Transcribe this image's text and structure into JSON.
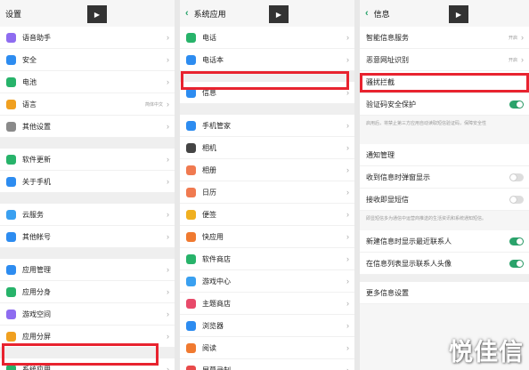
{
  "colors": {
    "accent": "#2aa36b",
    "highlight": "#e8232f"
  },
  "play_glyph": "▶",
  "panel1": {
    "title": "设置",
    "items": [
      {
        "label": "语音助手",
        "icon": "mic-icon",
        "color": "#8e6cf0"
      },
      {
        "label": "安全",
        "icon": "shield-icon",
        "color": "#2d8cf0"
      },
      {
        "label": "电池",
        "icon": "battery-icon",
        "color": "#27b36a"
      },
      {
        "label": "语言",
        "value": "简体中文",
        "icon": "globe-icon",
        "color": "#f0a020"
      },
      {
        "label": "其他设置",
        "icon": "gear-icon",
        "color": "#8a8a8a"
      },
      {
        "label": "软件更新",
        "icon": "update-icon",
        "color": "#27b36a"
      },
      {
        "label": "关于手机",
        "icon": "info-icon",
        "color": "#2d8cf0"
      },
      {
        "label": "云服务",
        "icon": "cloud-icon",
        "color": "#3aa0f0"
      },
      {
        "label": "其他帐号",
        "icon": "user-icon",
        "color": "#2d8cf0"
      },
      {
        "label": "应用管理",
        "icon": "grid-icon",
        "color": "#2d8cf0"
      },
      {
        "label": "应用分身",
        "icon": "clone-icon",
        "color": "#27b36a"
      },
      {
        "label": "游戏空间",
        "icon": "game-icon",
        "color": "#8e6cf0"
      },
      {
        "label": "应用分屏",
        "icon": "split-icon",
        "color": "#f0a020"
      },
      {
        "label": "系统应用",
        "icon": "apps-icon",
        "color": "#27b36a"
      }
    ]
  },
  "panel2": {
    "title": "系统应用",
    "items": [
      {
        "label": "电话",
        "icon": "phone-icon",
        "color": "#27b36a"
      },
      {
        "label": "电话本",
        "icon": "contacts-icon",
        "color": "#2d8cf0"
      },
      {
        "label": "信息",
        "icon": "message-icon",
        "color": "#2d8cf0"
      },
      {
        "label": "手机管家",
        "icon": "shield-icon",
        "color": "#2d8cf0"
      },
      {
        "label": "相机",
        "icon": "camera-icon",
        "color": "#444"
      },
      {
        "label": "相册",
        "icon": "photos-icon",
        "color": "#f07a50"
      },
      {
        "label": "日历",
        "icon": "calendar-icon",
        "color": "#f07a50"
      },
      {
        "label": "便签",
        "icon": "notes-icon",
        "color": "#f0b020"
      },
      {
        "label": "快应用",
        "icon": "quickapp-icon",
        "color": "#f07a30"
      },
      {
        "label": "软件商店",
        "icon": "store-icon",
        "color": "#27b36a"
      },
      {
        "label": "游戏中心",
        "icon": "star-icon",
        "color": "#3aa0f0"
      },
      {
        "label": "主题商店",
        "icon": "theme-icon",
        "color": "#e84a6a"
      },
      {
        "label": "浏览器",
        "icon": "browser-icon",
        "color": "#2d8cf0"
      },
      {
        "label": "阅读",
        "icon": "book-icon",
        "color": "#f07a30"
      },
      {
        "label": "屏幕录制",
        "icon": "record-icon",
        "color": "#e84a4a"
      }
    ]
  },
  "panel3": {
    "title": "信息",
    "smart_service": {
      "label": "智能信息服务",
      "value": "开启"
    },
    "fraud_url": {
      "label": "恶意网址识别",
      "value": "开启"
    },
    "harass": {
      "label": "骚扰拦截"
    },
    "verify_code": {
      "label": "验证码安全保护",
      "toggle": "on"
    },
    "verify_note": "启用后，将禁止第三方应用自动读取短信验证码，保障安全性",
    "notify": {
      "label": "通知管理"
    },
    "popup": {
      "label": "收到信息时弹窗显示",
      "toggle": "off"
    },
    "instant": {
      "label": "接收即显短信",
      "toggle": "off"
    },
    "instant_note": "即显短信多为通信中运营商推送的生活资讯和系统通知短信。",
    "recent": {
      "label": "新建信息时显示最近联系人",
      "toggle": "on"
    },
    "avatar": {
      "label": "在信息列表显示联系人头像",
      "toggle": "on"
    },
    "more": {
      "label": "更多信息设置"
    }
  },
  "watermark": "悦佳信"
}
